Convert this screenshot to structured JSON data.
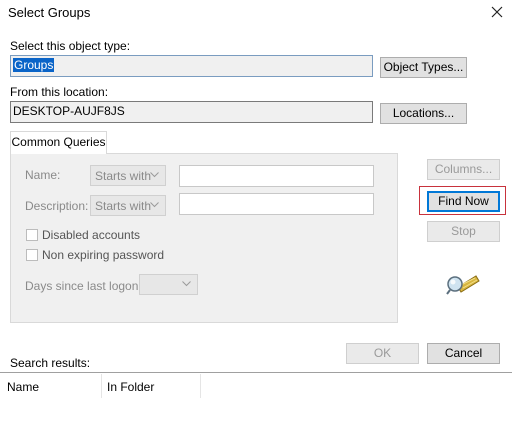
{
  "window": {
    "title": "Select Groups",
    "close_icon": "close-icon"
  },
  "object_type": {
    "label": "Select this object type:",
    "value": "Groups",
    "button": "Object Types..."
  },
  "location": {
    "label": "From this location:",
    "value": "DESKTOP-AUJF8JS",
    "button": "Locations..."
  },
  "queries": {
    "tab_label": "Common Queries",
    "name_label": "Name:",
    "name_mode": "Starts with",
    "name_value": "",
    "description_label": "Description:",
    "description_mode": "Starts with",
    "description_value": "",
    "disabled_accounts": {
      "label": "Disabled accounts",
      "checked": false
    },
    "non_expiring": {
      "label": "Non expiring password",
      "checked": false
    },
    "days_label": "Days since last logon:",
    "days_value": ""
  },
  "side_buttons": {
    "columns": "Columns...",
    "find_now": "Find Now",
    "stop": "Stop",
    "search_icon": "search-flashlight-icon"
  },
  "footer": {
    "ok": "OK",
    "cancel": "Cancel"
  },
  "results": {
    "label": "Search results:",
    "columns": [
      "Name",
      "In Folder"
    ],
    "rows": []
  }
}
